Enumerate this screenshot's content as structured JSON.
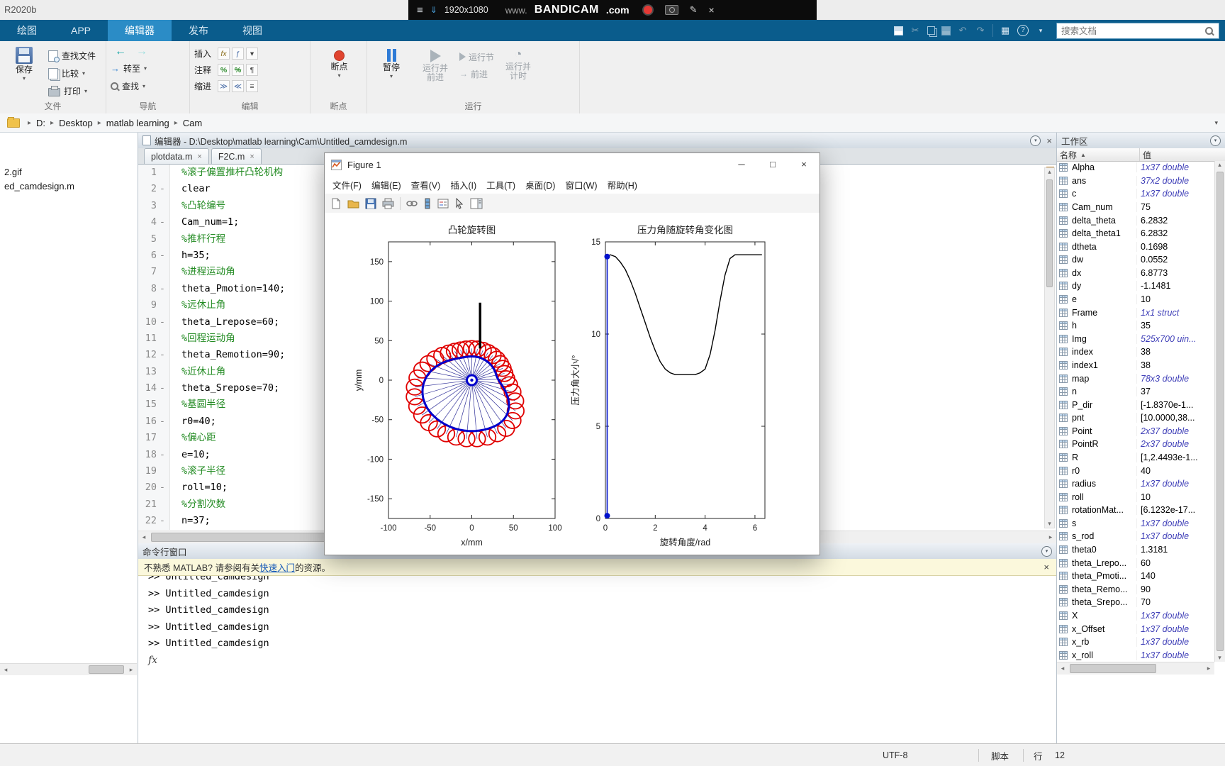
{
  "window": {
    "title_fragment": "R2020b"
  },
  "bandicam": {
    "resolution": "1920x1080",
    "logo_www": "www.",
    "logo_main": "BANDICAM",
    "logo_tld": ".com"
  },
  "icons": {
    "caret": "▾",
    "sort_asc": "▲",
    "close": "×",
    "minimize": "─",
    "maximize": "□",
    "menu": "≡",
    "pin": "⇓",
    "pencil": "✎",
    "scissors": "✂",
    "undo": "↶",
    "redo": "↷",
    "window_grid": "▦",
    "help": "?",
    "breadcrumb_sep": "▸",
    "back_arrow": "←",
    "forward_arrow": "→",
    "goto_arrow": "→",
    "advance_arrow": "→",
    "timer": "◔",
    "scroll_left": "◂",
    "scroll_right": "▸",
    "scroll_up": "▴",
    "scroll_down": "▾",
    "fx_chip": "fx",
    "fx2_chip": "ƒ",
    "percent": "%",
    "percent_strike": "%",
    "wrap_comment": "¶",
    "indent_right": "≫",
    "indent_left": "≪",
    "indent_eq": "≡"
  },
  "toolstrip": {
    "tabs": [
      {
        "label": "绘图",
        "selected": false
      },
      {
        "label": "APP",
        "selected": false
      },
      {
        "label": "编辑器",
        "selected": true
      },
      {
        "label": "发布",
        "selected": false
      },
      {
        "label": "视图",
        "selected": false
      }
    ],
    "search_placeholder": "搜索文档",
    "sections": {
      "file": {
        "label": "文件",
        "save": "保存",
        "find_files": "查找文件",
        "compare": "比较",
        "print": "打印"
      },
      "navigate": {
        "label": "导航",
        "goto": "转至",
        "find": "查找"
      },
      "edit": {
        "label": "编辑",
        "insert": "插入",
        "comment": "注释",
        "indent": "缩进"
      },
      "breakpoints": {
        "label": "断点",
        "button": "断点"
      },
      "run": {
        "label": "运行",
        "pause": "暂停",
        "run_advance_1": "运行并",
        "run_advance_2": "前进",
        "run_section": "运行节",
        "advance": "前进",
        "run_time_1": "运行并",
        "run_time_2": "计时"
      }
    }
  },
  "breadcrumb": {
    "items": [
      "D:",
      "Desktop",
      "matlab learning",
      "Cam"
    ]
  },
  "current_folder": {
    "items": [
      "2.gif",
      "ed_camdesign.m"
    ]
  },
  "editor": {
    "title": "编辑器 - D:\\Desktop\\matlab learning\\Cam\\Untitled_camdesign.m",
    "tabs": [
      {
        "label": "plotdata.m"
      },
      {
        "label": "F2C.m"
      }
    ],
    "lines": [
      {
        "n": 1,
        "exec": false,
        "type": "comment",
        "text": "%滚子偏置推杆凸轮机构"
      },
      {
        "n": 2,
        "exec": true,
        "type": "code",
        "text": "clear"
      },
      {
        "n": 3,
        "exec": false,
        "type": "comment",
        "text": "%凸轮编号"
      },
      {
        "n": 4,
        "exec": true,
        "type": "code",
        "text": "Cam_num=1;"
      },
      {
        "n": 5,
        "exec": false,
        "type": "comment",
        "text": "%推杆行程"
      },
      {
        "n": 6,
        "exec": true,
        "type": "code",
        "text": "h=35;"
      },
      {
        "n": 7,
        "exec": false,
        "type": "comment",
        "text": "%进程运动角"
      },
      {
        "n": 8,
        "exec": true,
        "type": "code",
        "text": "theta_Pmotion=140;"
      },
      {
        "n": 9,
        "exec": false,
        "type": "comment",
        "text": "%远休止角"
      },
      {
        "n": 10,
        "exec": true,
        "type": "code",
        "text": "theta_Lrepose=60;"
      },
      {
        "n": 11,
        "exec": false,
        "type": "comment",
        "text": "%回程运动角"
      },
      {
        "n": 12,
        "exec": true,
        "type": "code",
        "text": "theta_Remotion=90;"
      },
      {
        "n": 13,
        "exec": false,
        "type": "comment",
        "text": "%近休止角"
      },
      {
        "n": 14,
        "exec": true,
        "type": "code",
        "text": "theta_Srepose=70;"
      },
      {
        "n": 15,
        "exec": false,
        "type": "comment",
        "text": "%基圆半径"
      },
      {
        "n": 16,
        "exec": true,
        "type": "code",
        "text": "r0=40;"
      },
      {
        "n": 17,
        "exec": false,
        "type": "comment",
        "text": "%偏心距"
      },
      {
        "n": 18,
        "exec": true,
        "type": "code",
        "text": "e=10;"
      },
      {
        "n": 19,
        "exec": false,
        "type": "comment",
        "text": "%滚子半径"
      },
      {
        "n": 20,
        "exec": true,
        "type": "code",
        "text": "roll=10;"
      },
      {
        "n": 21,
        "exec": false,
        "type": "comment",
        "text": "%分割次数"
      },
      {
        "n": 22,
        "exec": true,
        "type": "code",
        "text": "n=37;"
      }
    ]
  },
  "command_window": {
    "title": "命令行窗口",
    "notice": {
      "prefix": "不熟悉 MATLAB? 请参阅有关",
      "link": "快速入门",
      "suffix": "的资源。"
    },
    "lines": [
      ">> Untitled_camdesign",
      ">> Untitled_camdesign",
      ">> Untitled_camdesign",
      ">> Untitled_camdesign",
      ">> Untitled_camdesign"
    ],
    "prompt": "fx"
  },
  "workspace": {
    "title": "工作区",
    "columns": [
      "名称",
      "值"
    ],
    "rows": [
      {
        "name": "Alpha",
        "value": "1x37 double",
        "italic": true
      },
      {
        "name": "ans",
        "value": "37x2 double",
        "italic": true
      },
      {
        "name": "c",
        "value": "1x37 double",
        "italic": true
      },
      {
        "name": "Cam_num",
        "value": "75",
        "italic": false
      },
      {
        "name": "delta_theta",
        "value": "6.2832",
        "italic": false
      },
      {
        "name": "delta_theta1",
        "value": "6.2832",
        "italic": false
      },
      {
        "name": "dtheta",
        "value": "0.1698",
        "italic": false
      },
      {
        "name": "dw",
        "value": "0.0552",
        "italic": false
      },
      {
        "name": "dx",
        "value": "6.8773",
        "italic": false
      },
      {
        "name": "dy",
        "value": "-1.1481",
        "italic": false
      },
      {
        "name": "e",
        "value": "10",
        "italic": false
      },
      {
        "name": "Frame",
        "value": "1x1 struct",
        "italic": true
      },
      {
        "name": "h",
        "value": "35",
        "italic": false
      },
      {
        "name": "Img",
        "value": "525x700 uin...",
        "italic": true
      },
      {
        "name": "index",
        "value": "38",
        "italic": false
      },
      {
        "name": "index1",
        "value": "38",
        "italic": false
      },
      {
        "name": "map",
        "value": "78x3 double",
        "italic": true
      },
      {
        "name": "n",
        "value": "37",
        "italic": false
      },
      {
        "name": "P_dir",
        "value": "[-1.8370e-1...",
        "italic": false
      },
      {
        "name": "pnt",
        "value": "[10.0000,38...",
        "italic": false
      },
      {
        "name": "Point",
        "value": "2x37 double",
        "italic": true
      },
      {
        "name": "PointR",
        "value": "2x37 double",
        "italic": true
      },
      {
        "name": "R",
        "value": "[1,2.4493e-1...",
        "italic": false
      },
      {
        "name": "r0",
        "value": "40",
        "italic": false
      },
      {
        "name": "radius",
        "value": "1x37 double",
        "italic": true
      },
      {
        "name": "roll",
        "value": "10",
        "italic": false
      },
      {
        "name": "rotationMat...",
        "value": "[6.1232e-17...",
        "italic": false
      },
      {
        "name": "s",
        "value": "1x37 double",
        "italic": true
      },
      {
        "name": "s_rod",
        "value": "1x37 double",
        "italic": true
      },
      {
        "name": "theta0",
        "value": "1.3181",
        "italic": false
      },
      {
        "name": "theta_Lrepo...",
        "value": "60",
        "italic": false
      },
      {
        "name": "theta_Pmoti...",
        "value": "140",
        "italic": false
      },
      {
        "name": "theta_Remo...",
        "value": "90",
        "italic": false
      },
      {
        "name": "theta_Srepo...",
        "value": "70",
        "italic": false
      },
      {
        "name": "X",
        "value": "1x37 double",
        "italic": true
      },
      {
        "name": "x_Offset",
        "value": "1x37 double",
        "italic": true
      },
      {
        "name": "x_rb",
        "value": "1x37 double",
        "italic": true
      },
      {
        "name": "x_roll",
        "value": "1x37 double",
        "italic": true
      }
    ]
  },
  "status_bar": {
    "encoding": "UTF-8",
    "type": "脚本",
    "line_label": "行",
    "line": "12"
  },
  "figure_window": {
    "title": "Figure 1",
    "menus": [
      "文件(F)",
      "编辑(E)",
      "查看(V)",
      "插入(I)",
      "工具(T)",
      "桌面(D)",
      "窗口(W)",
      "帮助(H)"
    ]
  },
  "chart_data": [
    {
      "type": "scatter",
      "title": "凸轮旋转图",
      "xlabel": "x/mm",
      "ylabel": "y/mm",
      "xlim": [
        -100,
        100
      ],
      "ylim": [
        -175,
        175
      ],
      "xticks": [
        -100,
        -50,
        0,
        50,
        100
      ],
      "yticks": [
        -150,
        -100,
        -50,
        0,
        50,
        100,
        150
      ],
      "grid": false,
      "cam": {
        "base_radius": 40,
        "offset": 10,
        "roller_radius": 10,
        "stroke": 35,
        "n_rollers": 37,
        "rise_deg": 140,
        "far_dwell_deg": 60,
        "return_deg": 90,
        "near_dwell_deg": 70,
        "profile_color": "#0000cc",
        "roller_color": "#e00000",
        "spoke_color": "#303099",
        "follower": {
          "x": 10,
          "y1": 40,
          "y2": 98,
          "color": "#000000"
        }
      }
    },
    {
      "type": "line",
      "title": "压力角随旋转角变化图",
      "xlabel": "旋转角度/rad",
      "ylabel": "压力角大小/°",
      "xlim": [
        0,
        6.4
      ],
      "ylim": [
        0,
        15
      ],
      "xticks": [
        0,
        2,
        4,
        6
      ],
      "yticks": [
        0,
        5,
        10,
        15
      ],
      "grid": false,
      "series": [
        {
          "name": "pressure_angle",
          "color": "#000000",
          "x": [
            0,
            0.2,
            0.4,
            0.6,
            0.8,
            1.0,
            1.2,
            1.4,
            1.6,
            1.8,
            2.0,
            2.2,
            2.4,
            2.6,
            2.8,
            3.0,
            3.2,
            3.4,
            3.6,
            3.8,
            4.0,
            4.2,
            4.4,
            4.6,
            4.8,
            5.0,
            5.2,
            5.4,
            5.6,
            5.8,
            6.0,
            6.28
          ],
          "y": [
            14.2,
            14.3,
            14.2,
            13.9,
            13.5,
            12.9,
            12.2,
            11.4,
            10.6,
            9.8,
            9.1,
            8.5,
            8.1,
            7.9,
            7.8,
            7.8,
            7.8,
            7.8,
            7.8,
            7.9,
            8.1,
            8.9,
            10.2,
            11.8,
            13.2,
            14.1,
            14.3,
            14.3,
            14.3,
            14.3,
            14.3,
            14.3
          ]
        }
      ],
      "marker_line": {
        "x": 0.07,
        "y1": 0.15,
        "y2": 14.2,
        "color": "#0011cc"
      }
    }
  ]
}
